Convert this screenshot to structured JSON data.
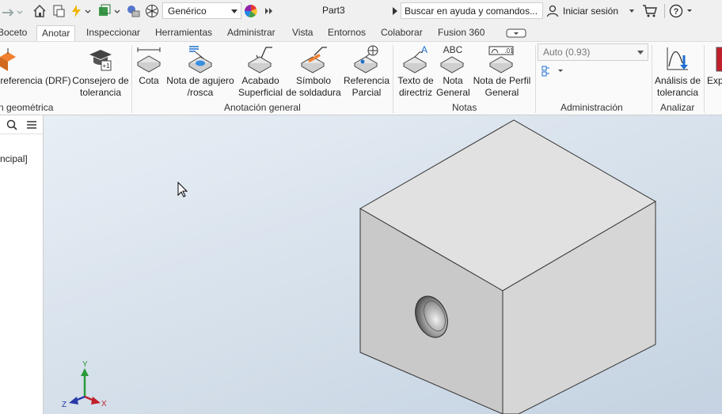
{
  "titlebar": {
    "style_value": "Genérico",
    "document_title": "Part3",
    "search_placeholder": "Buscar en ayuda y comandos...",
    "signin_label": "Iniciar sesión"
  },
  "tabs": [
    {
      "label": "Boceto"
    },
    {
      "label": "Anotar",
      "active": true
    },
    {
      "label": "Inspeccionar"
    },
    {
      "label": "Herramientas"
    },
    {
      "label": "Administrar"
    },
    {
      "label": "Vista"
    },
    {
      "label": "Entornos"
    },
    {
      "label": "Colaborar"
    },
    {
      "label": "Fusion 360"
    }
  ],
  "ribbon": {
    "buttons": {
      "drf": {
        "line1": "referencia (DRF)",
        "line2": ""
      },
      "tolerance_advisor": {
        "line1": "Consejero de",
        "line2": "tolerancia"
      },
      "dimension": {
        "line1": "Cota",
        "line2": ""
      },
      "hole_note": {
        "line1": "Nota de agujero",
        "line2": "/rosca"
      },
      "surface_finish": {
        "line1": "Acabado",
        "line2": "Superficial"
      },
      "weld_symbol": {
        "line1": "Símbolo",
        "line2": "de soldadura"
      },
      "partial_reference": {
        "line1": "Referencia",
        "line2": "Parcial"
      },
      "leader_text": {
        "line1": "Texto de",
        "line2": "directriz"
      },
      "general_note": {
        "line1": "Nota",
        "line2": "General"
      },
      "general_profile_note": {
        "line1": "Nota de Perfil",
        "line2": "General"
      },
      "tolerance_analysis": {
        "line1": "Análisis de",
        "line2": "tolerancia"
      },
      "export": {
        "line1": "Exp",
        "line2": ""
      }
    },
    "panels": {
      "geometric": "n geométrica",
      "general_annotation": "Anotación general",
      "notes": "Notas",
      "management": "Administración",
      "analyze": "Analizar"
    },
    "auto_select_value": "Auto (0.93)",
    "general_note_icon_text": "ABC",
    "leader_text_icon_letter": "A",
    "profile_note_icon_text": ".01"
  },
  "browser": {
    "node_label": "ncipal]"
  },
  "viewcube_axes": {
    "x": "X",
    "y": "Y",
    "z": "Z"
  },
  "colors": {
    "active_tab_bg": "#ffffff",
    "viewport_top": "#e8eef5",
    "viewport_bottom": "#c4d2e1",
    "x_axis": "#c0202a",
    "y_axis": "#2a9a3a",
    "z_axis": "#2a3aa8"
  }
}
